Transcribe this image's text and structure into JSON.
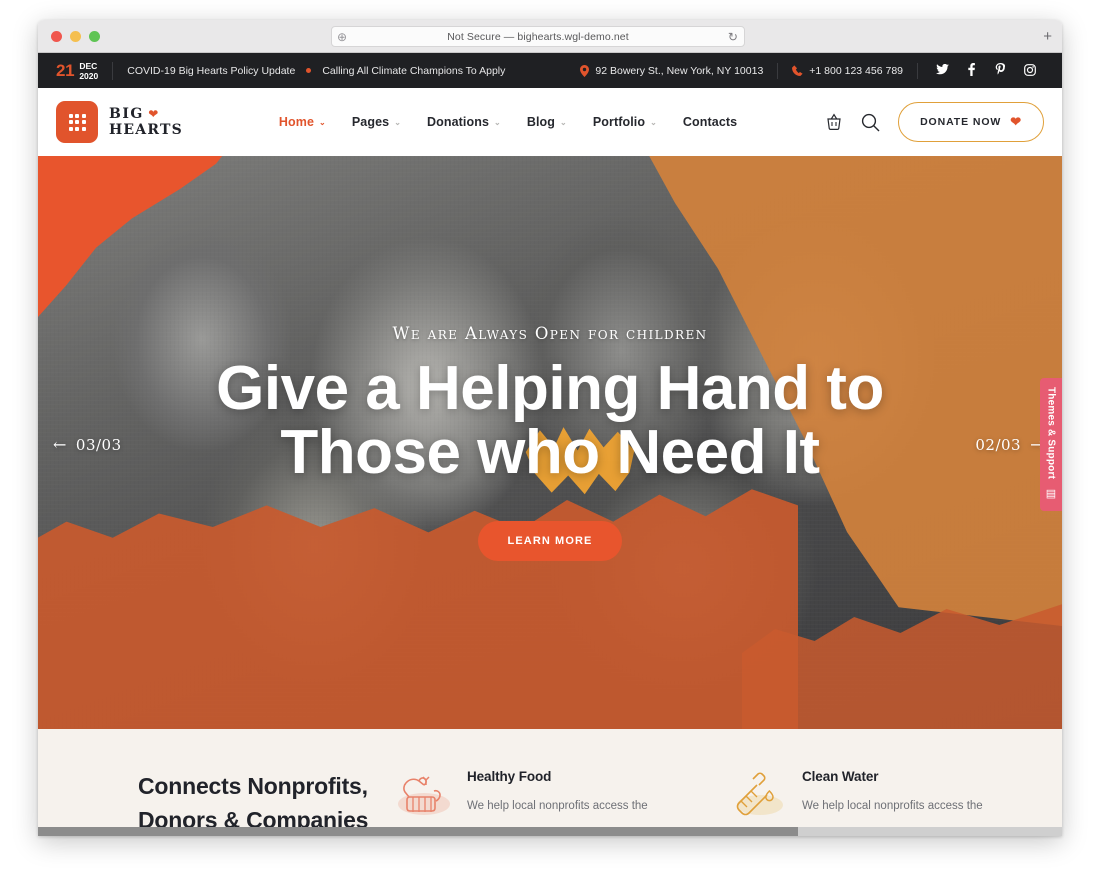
{
  "browser": {
    "url_text": "Not Secure — bighearts.wgl-demo.net",
    "new_tab_label": "+",
    "reload_icon": "↻",
    "info_icon": "⊕"
  },
  "topbar": {
    "date": {
      "day": "21",
      "month": "DEC",
      "year": "2020"
    },
    "ticker": [
      "COVID-19 Big Hearts Policy Update",
      "Calling All Climate Champions To Apply"
    ],
    "address": "92 Bowery St., New York, NY 10013",
    "phone": "+1 800 123 456 789",
    "location_icon": "📍",
    "phone_icon": "📞",
    "socials": [
      {
        "name": "twitter-icon",
        "glyph": "🐦"
      },
      {
        "name": "facebook-icon",
        "glyph": "f"
      },
      {
        "name": "pinterest-icon",
        "glyph": "P"
      },
      {
        "name": "instagram-icon",
        "glyph": "◎"
      }
    ]
  },
  "header": {
    "logo": {
      "line1": "BIG",
      "line2": "HEARTS",
      "heart": "❤"
    },
    "nav": [
      {
        "label": "Home",
        "has_dropdown": true,
        "active": true
      },
      {
        "label": "Pages",
        "has_dropdown": true,
        "active": false
      },
      {
        "label": "Donations",
        "has_dropdown": true,
        "active": false
      },
      {
        "label": "Blog",
        "has_dropdown": true,
        "active": false
      },
      {
        "label": "Portfolio",
        "has_dropdown": true,
        "active": false
      },
      {
        "label": "Contacts",
        "has_dropdown": false,
        "active": false
      }
    ],
    "chevron": "⌄",
    "donate_label": "DONATE NOW",
    "donate_heart": "❤"
  },
  "hero": {
    "subtitle": "We are Always Open for children",
    "title_line1": "Give a Helping Hand to",
    "title_line2": "Those who Need It",
    "cta_label": "LEARN MORE",
    "prev": {
      "arrow": "←",
      "counter": "03/03"
    },
    "next": {
      "arrow": "→",
      "counter": "02/03"
    }
  },
  "side_tab": {
    "label": "Themes & Support",
    "icon": "▤"
  },
  "features": {
    "heading_line1": "Connects Nonprofits,",
    "heading_line2": "Donors & Companies",
    "items": [
      {
        "icon_name": "healthy-food-icon",
        "title": "Healthy Food",
        "text": "We help local nonprofits access the"
      },
      {
        "icon_name": "clean-water-icon",
        "title": "Clean Water",
        "text": "We help local nonprofits access the"
      }
    ]
  },
  "colors": {
    "brand_orange": "#e8552d",
    "accent_amber": "#e0a03a",
    "dark_bar": "#1f2023",
    "page_bg": "#f6f2ed",
    "side_tab_pink": "#e75c72"
  }
}
